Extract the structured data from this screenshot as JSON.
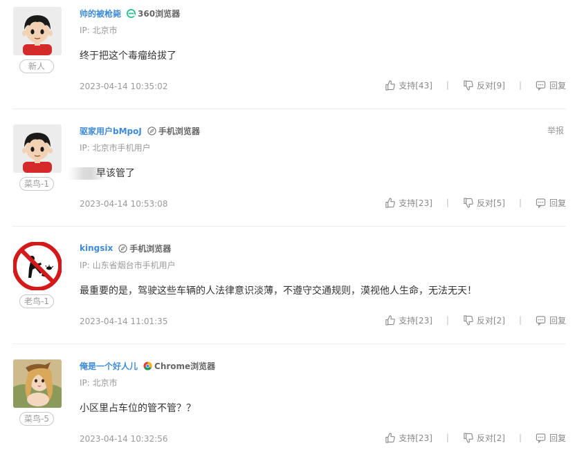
{
  "comments": [
    {
      "username": "帅的被枪毙",
      "browser": "360浏览器",
      "browser_icon": "ie-360-icon",
      "ip": "IP: 北京市",
      "content": "终于把这个毒瘤给拔了",
      "badge": "新人",
      "time": "2023-04-14 10:35:02",
      "support": "支持[43]",
      "oppose": "反对[9]",
      "reply": "回复"
    },
    {
      "username": "驱家用户bMpoJ",
      "browser": "手机浏览器",
      "browser_icon": "compass-icon",
      "ip": "IP: 北京市手机用户",
      "content": "早该管了",
      "badge": "菜鸟-1",
      "time": "2023-04-14 10:53:08",
      "support": "支持[23]",
      "oppose": "反对[5]",
      "reply": "回复",
      "report": "举报"
    },
    {
      "username": "kingsix",
      "browser": "手机浏览器",
      "browser_icon": "compass-icon",
      "ip": "IP: 山东省烟台市手机用户",
      "content": "最重要的是，驾驶这些车辆的人法律意识淡薄，不遵守交通规则，漠视他人生命，无法无天！",
      "badge": "老鸟-1",
      "time": "2023-04-14 11:01:35",
      "support": "支持[23]",
      "oppose": "反对[2]",
      "reply": "回复"
    },
    {
      "username": "俺是一个好人儿",
      "browser": "Chrome浏览器",
      "browser_icon": "chrome-icon",
      "ip": "IP: 北京市",
      "content": "小区里占车位的管不管？？",
      "badge": "菜鸟-5",
      "time": "2023-04-14 10:32:56",
      "support": "支持[23]",
      "oppose": "反对[2]",
      "reply": "回复"
    }
  ],
  "colors": {
    "username": "#3d8bd8",
    "muted": "#999999",
    "divider": "#ececec",
    "icon_360": "#2bbf8c"
  }
}
